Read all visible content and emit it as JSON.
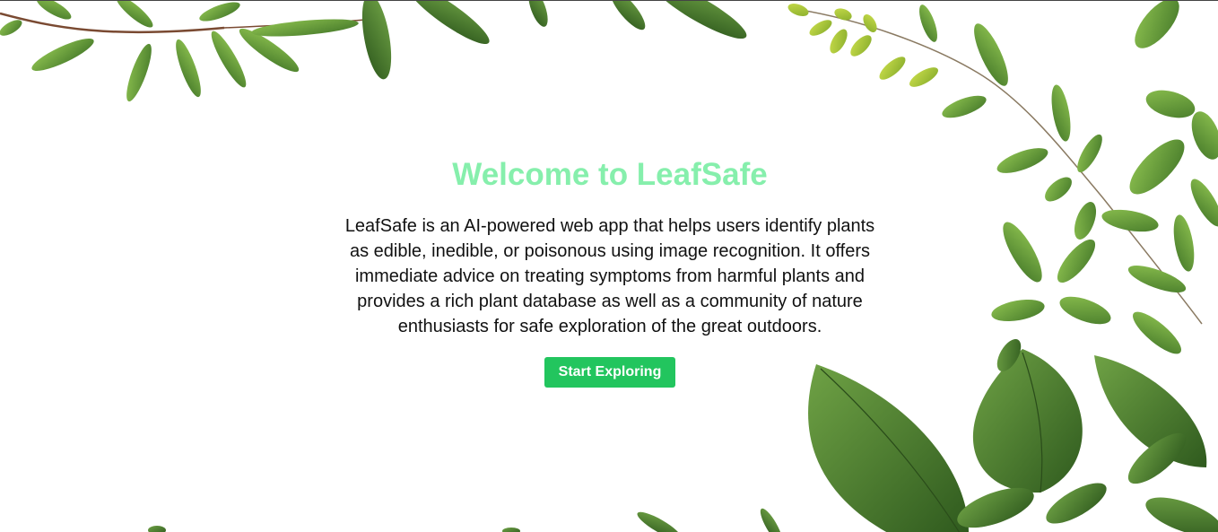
{
  "hero": {
    "title": "Welcome to LeafSafe",
    "description": "LeafSafe is an AI-powered web app that helps users identify plants as edible, inedible, or poisonous using image recognition. It offers immediate advice on treating symptoms from harmful plants and provides a rich plant database as well as a community of nature enthusiasts for safe exploration of the great outdoors.",
    "cta_label": "Start Exploring"
  },
  "colors": {
    "title": "#86efac",
    "button": "#22c55e",
    "leaf_dark": "#3f6b2a",
    "leaf_mid": "#5a8f35",
    "leaf_light": "#9ccc3a"
  },
  "decor": {
    "background_image": "leaf-border-icon"
  }
}
